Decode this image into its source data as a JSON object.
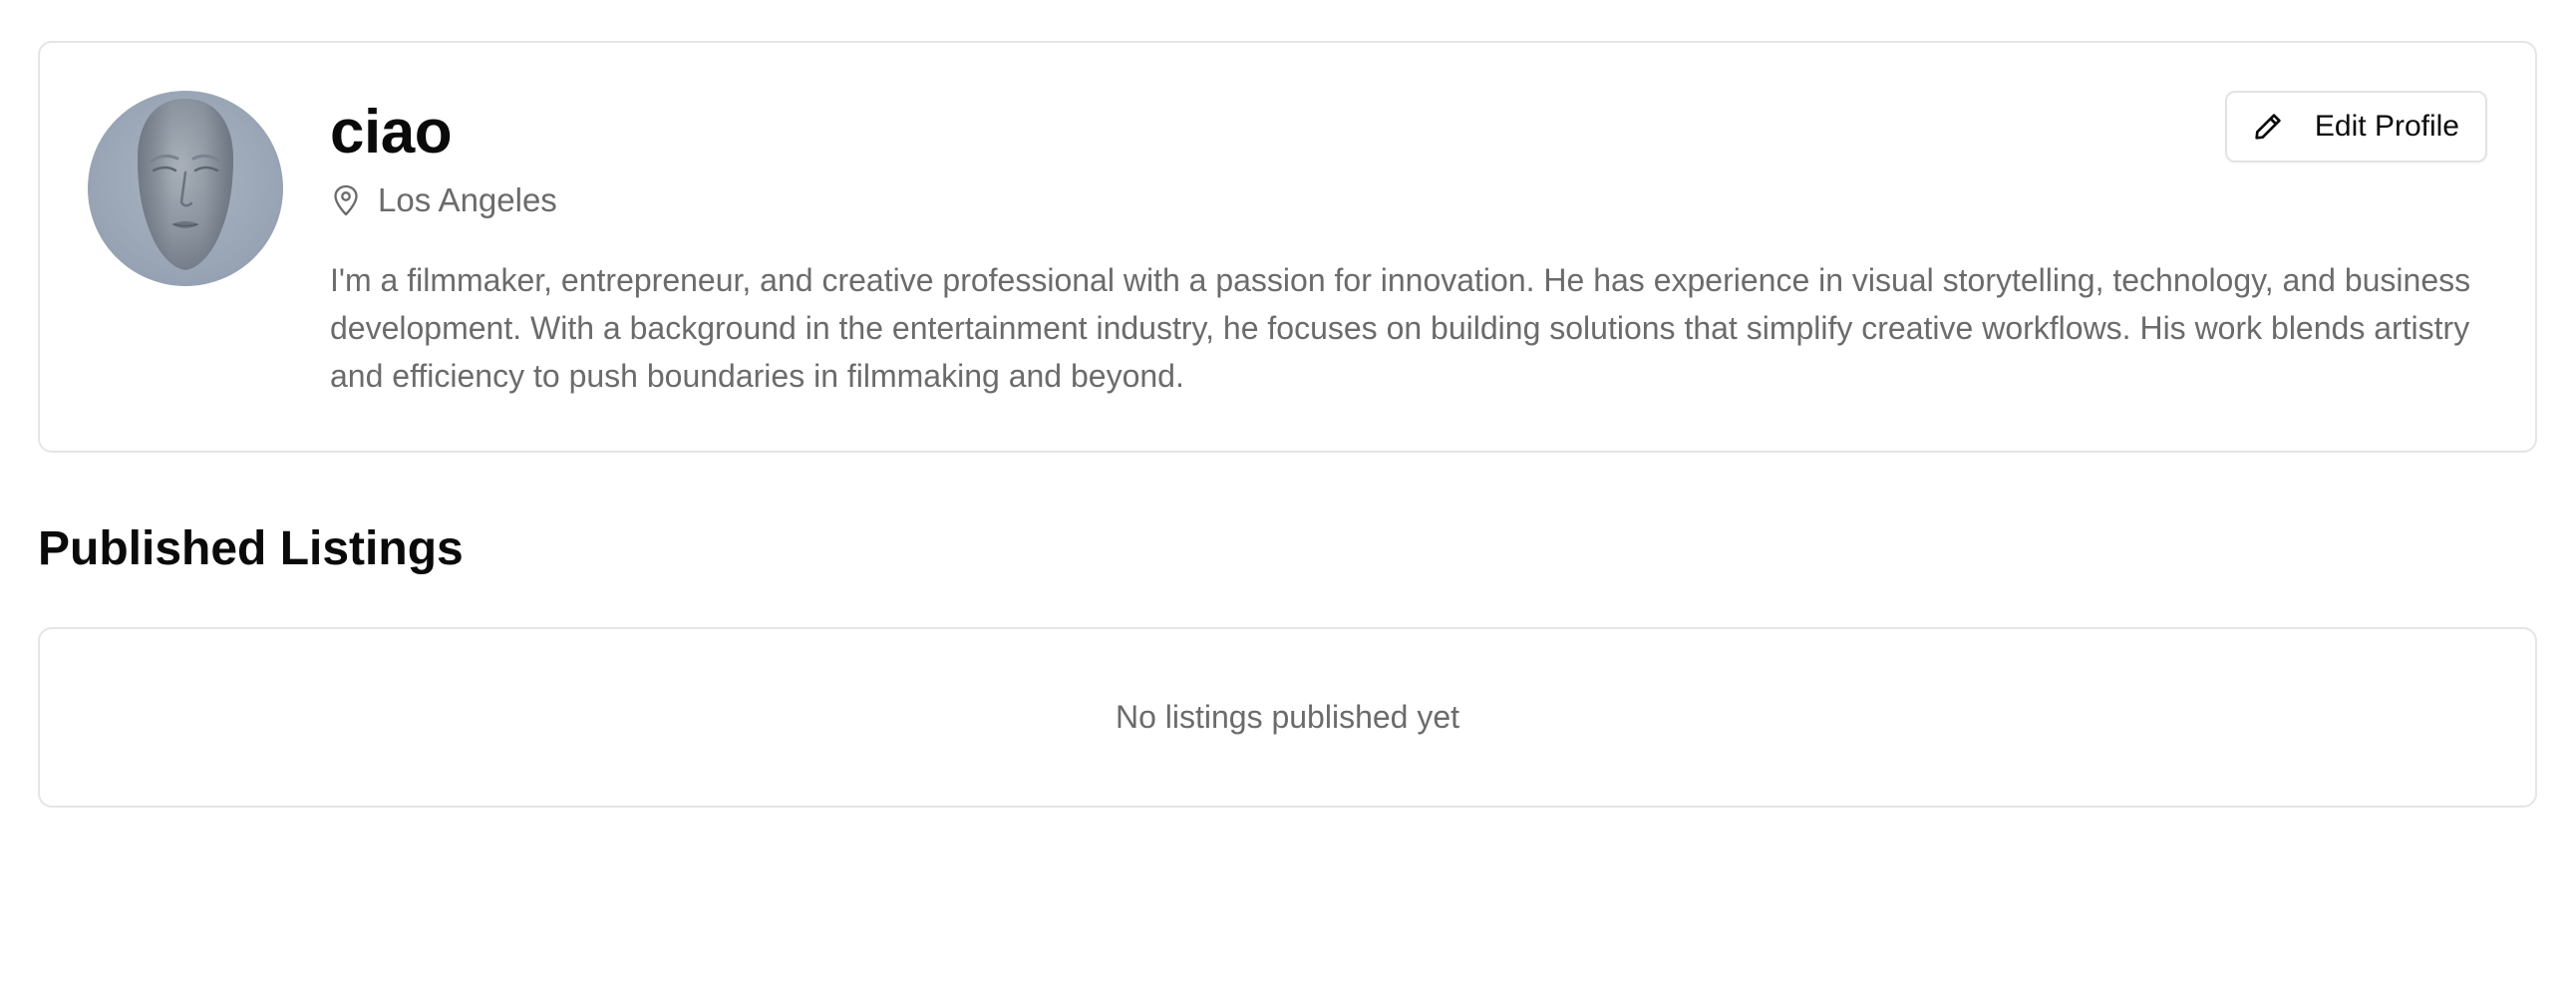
{
  "profile": {
    "name": "ciao",
    "location": "Los Angeles",
    "bio": "I'm a filmmaker, entrepreneur, and creative professional with a passion for innovation. He has experience in visual storytelling, technology, and business development. With a background in the entertainment industry, he focuses on building solutions that simplify creative workflows. His work blends artistry and efficiency to push boundaries in filmmaking and beyond.",
    "avatar_icon": "sculpted-face-avatar",
    "location_icon": "map-pin-icon",
    "edit_label": "Edit Profile",
    "edit_icon": "pencil-icon"
  },
  "listings": {
    "title": "Published Listings",
    "empty_message": "No listings published yet"
  },
  "colors": {
    "text_primary": "#0a0a0a",
    "text_muted": "#6b6b6b",
    "border": "#e5e5e5",
    "avatar_bg": "#9ba7b7"
  }
}
